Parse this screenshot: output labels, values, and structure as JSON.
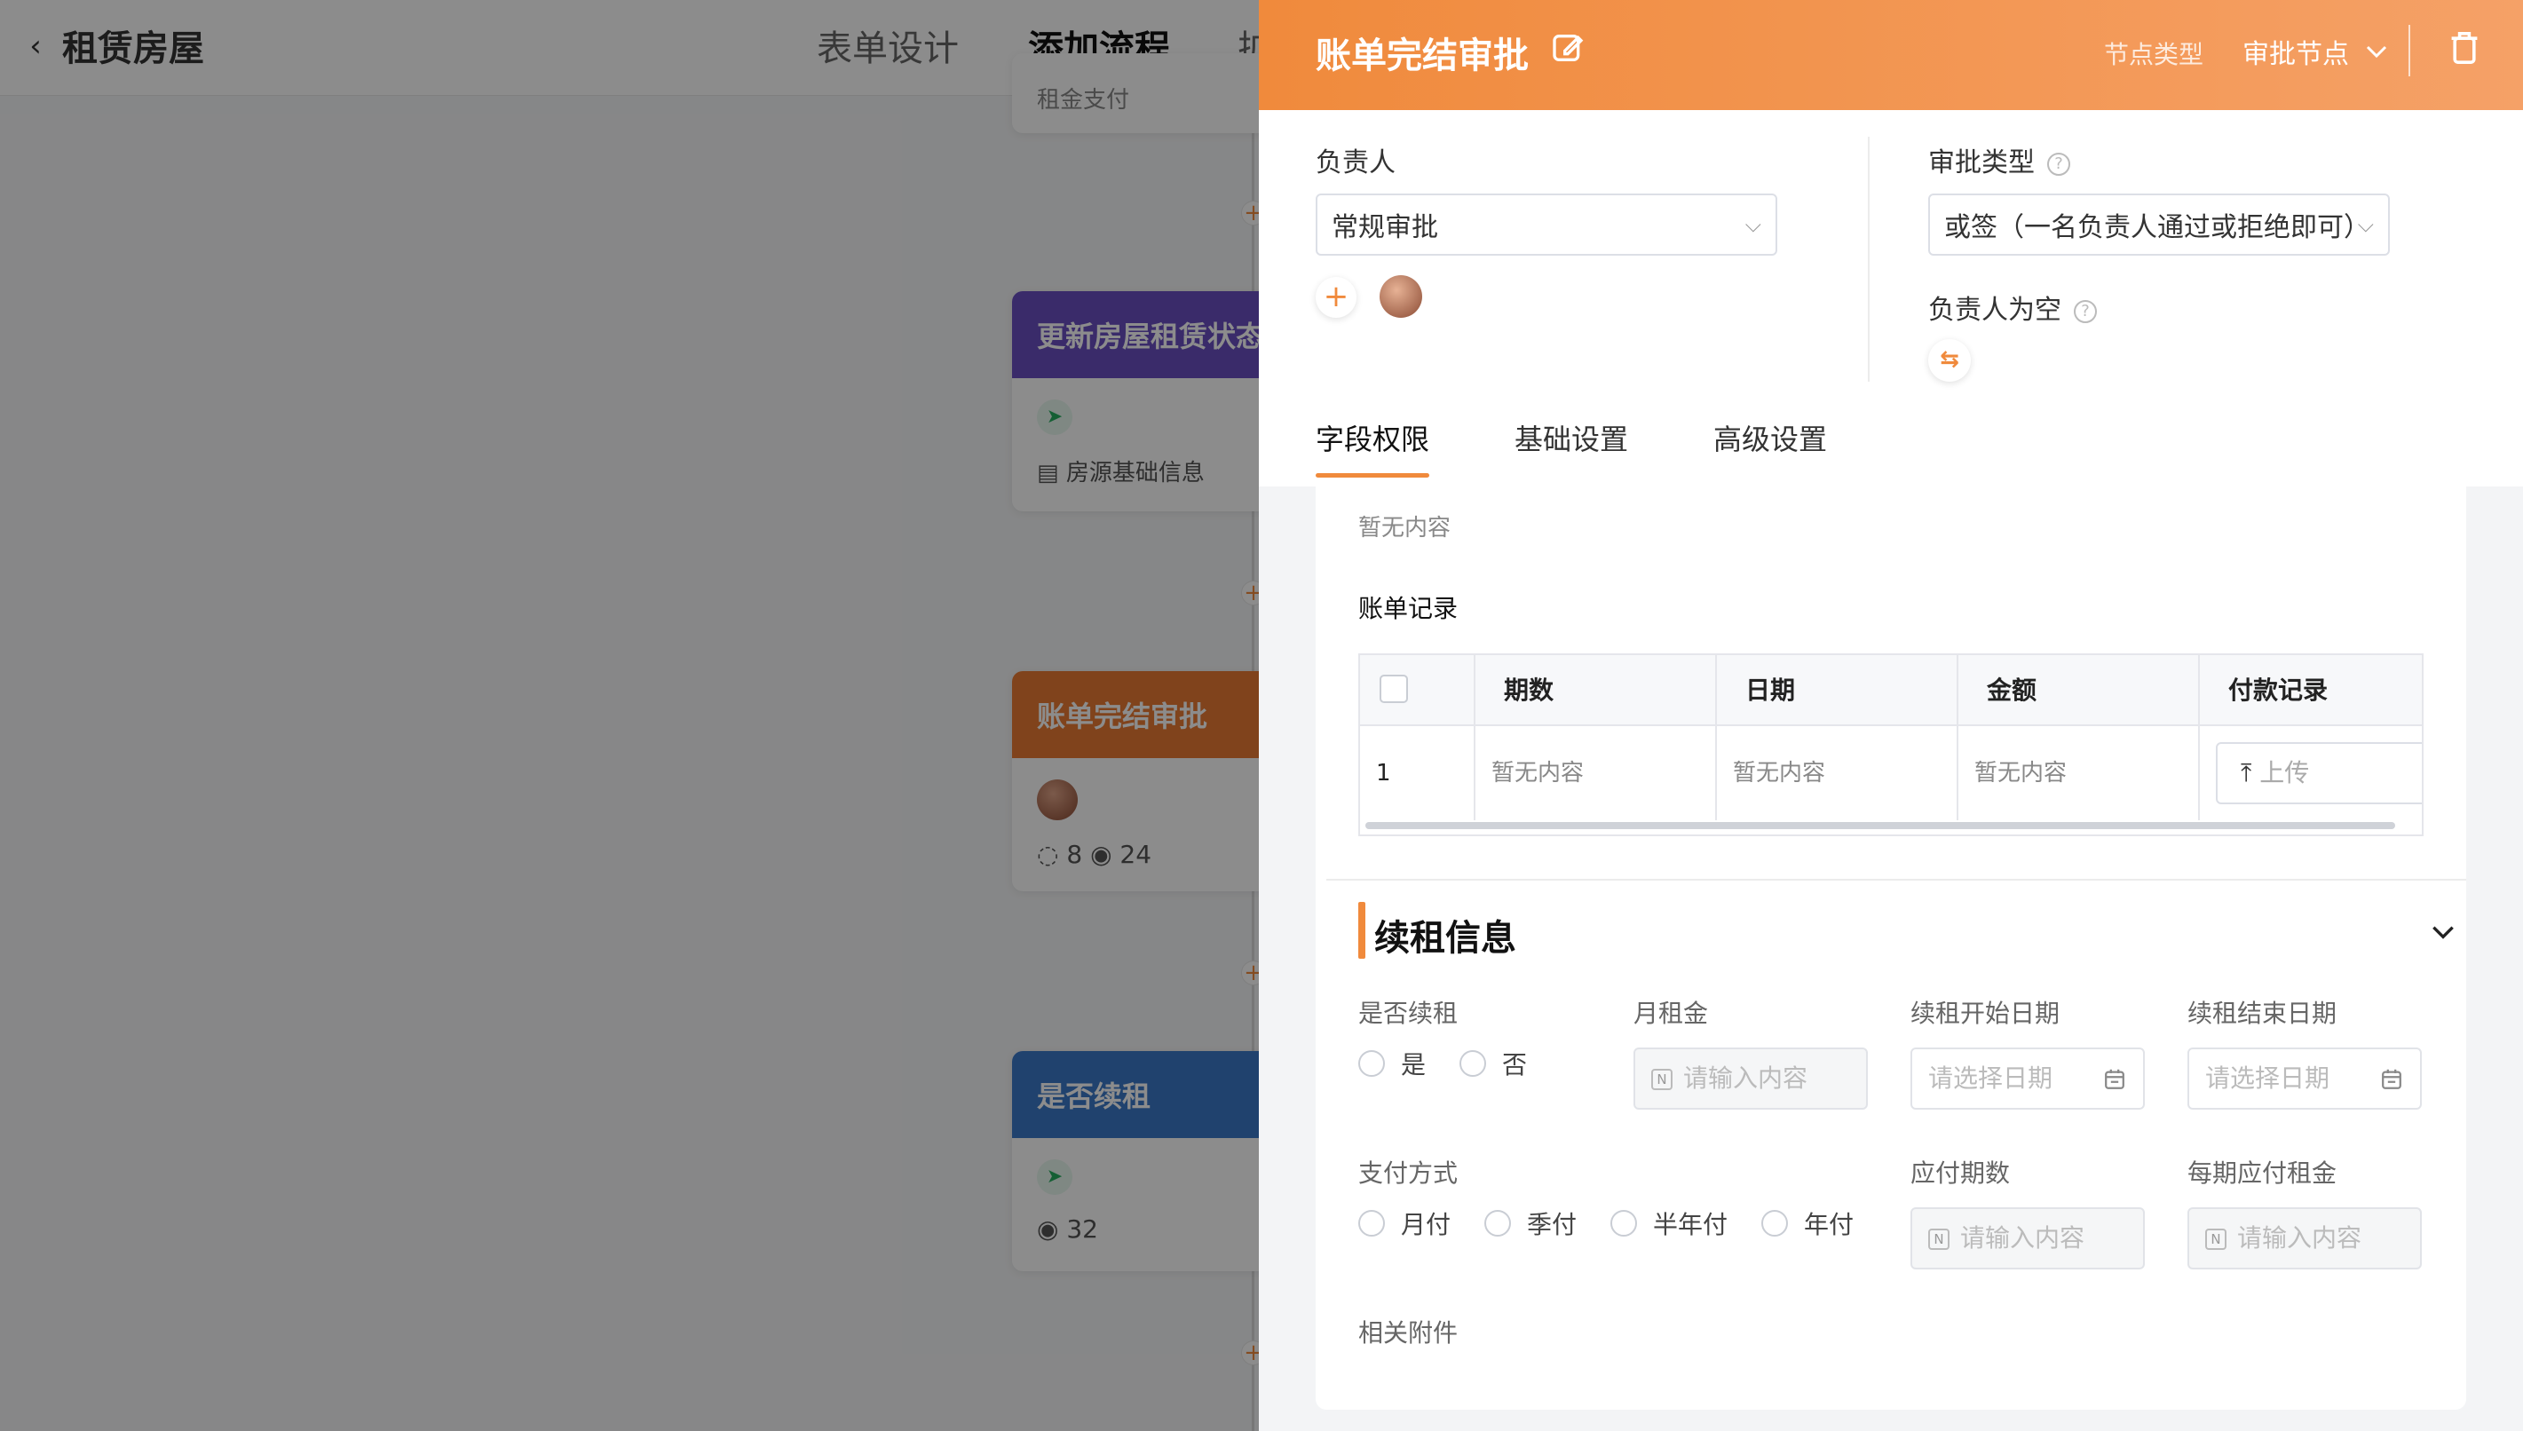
{
  "background": {
    "app_title": "租赁房屋",
    "tabs": [
      "表单设计",
      "添加流程",
      "扩"
    ],
    "nodes": {
      "top_partial_text": "租金支付",
      "update": {
        "title": "更新房屋租赁状态",
        "doc": "房源基础信息"
      },
      "approve": {
        "title": "账单完结审批",
        "hidden_count": "8",
        "view_count": "24"
      },
      "renew": {
        "title": "是否续租",
        "view_count": "32"
      }
    },
    "colors": {
      "purple": "#6a4fc2",
      "orange": "#e97b34",
      "blue": "#3b78c8"
    }
  },
  "drawer": {
    "title": "账单完结审批",
    "node_type_label": "节点类型",
    "node_type_value": "审批节点",
    "owner_label": "负责人",
    "owner_select": "常规审批",
    "approval_type_label": "审批类型",
    "approval_type_value": "或签（一名负责人通过或拒绝即可）",
    "empty_owner_label": "负责人为空",
    "tabs": [
      "字段权限",
      "基础设置",
      "高级设置"
    ],
    "accent": "#f08a3c"
  },
  "content": {
    "empty_top": "暂无内容",
    "bill_records_title": "账单记录",
    "table": {
      "headers": [
        "期数",
        "日期",
        "金额",
        "付款记录"
      ],
      "row": {
        "index": "1",
        "period": "暂无内容",
        "date": "暂无内容",
        "amount": "暂无内容",
        "upload": "上传"
      }
    },
    "renew_section": {
      "title": "续租信息",
      "is_renew_label": "是否续租",
      "is_renew_options": [
        "是",
        "否"
      ],
      "monthly_rent_label": "月租金",
      "monthly_rent_placeholder": "请输入内容",
      "renew_start_label": "续租开始日期",
      "renew_start_placeholder": "请选择日期",
      "renew_end_label": "续租结束日期",
      "renew_end_placeholder": "请选择日期",
      "payment_method_label": "支付方式",
      "payment_method_options": [
        "月付",
        "季付",
        "半年付",
        "年付"
      ],
      "periods_label": "应付期数",
      "periods_placeholder": "请输入内容",
      "rent_per_period_label": "每期应付租金",
      "rent_per_period_placeholder": "请输入内容",
      "attachments_label": "相关附件"
    }
  }
}
